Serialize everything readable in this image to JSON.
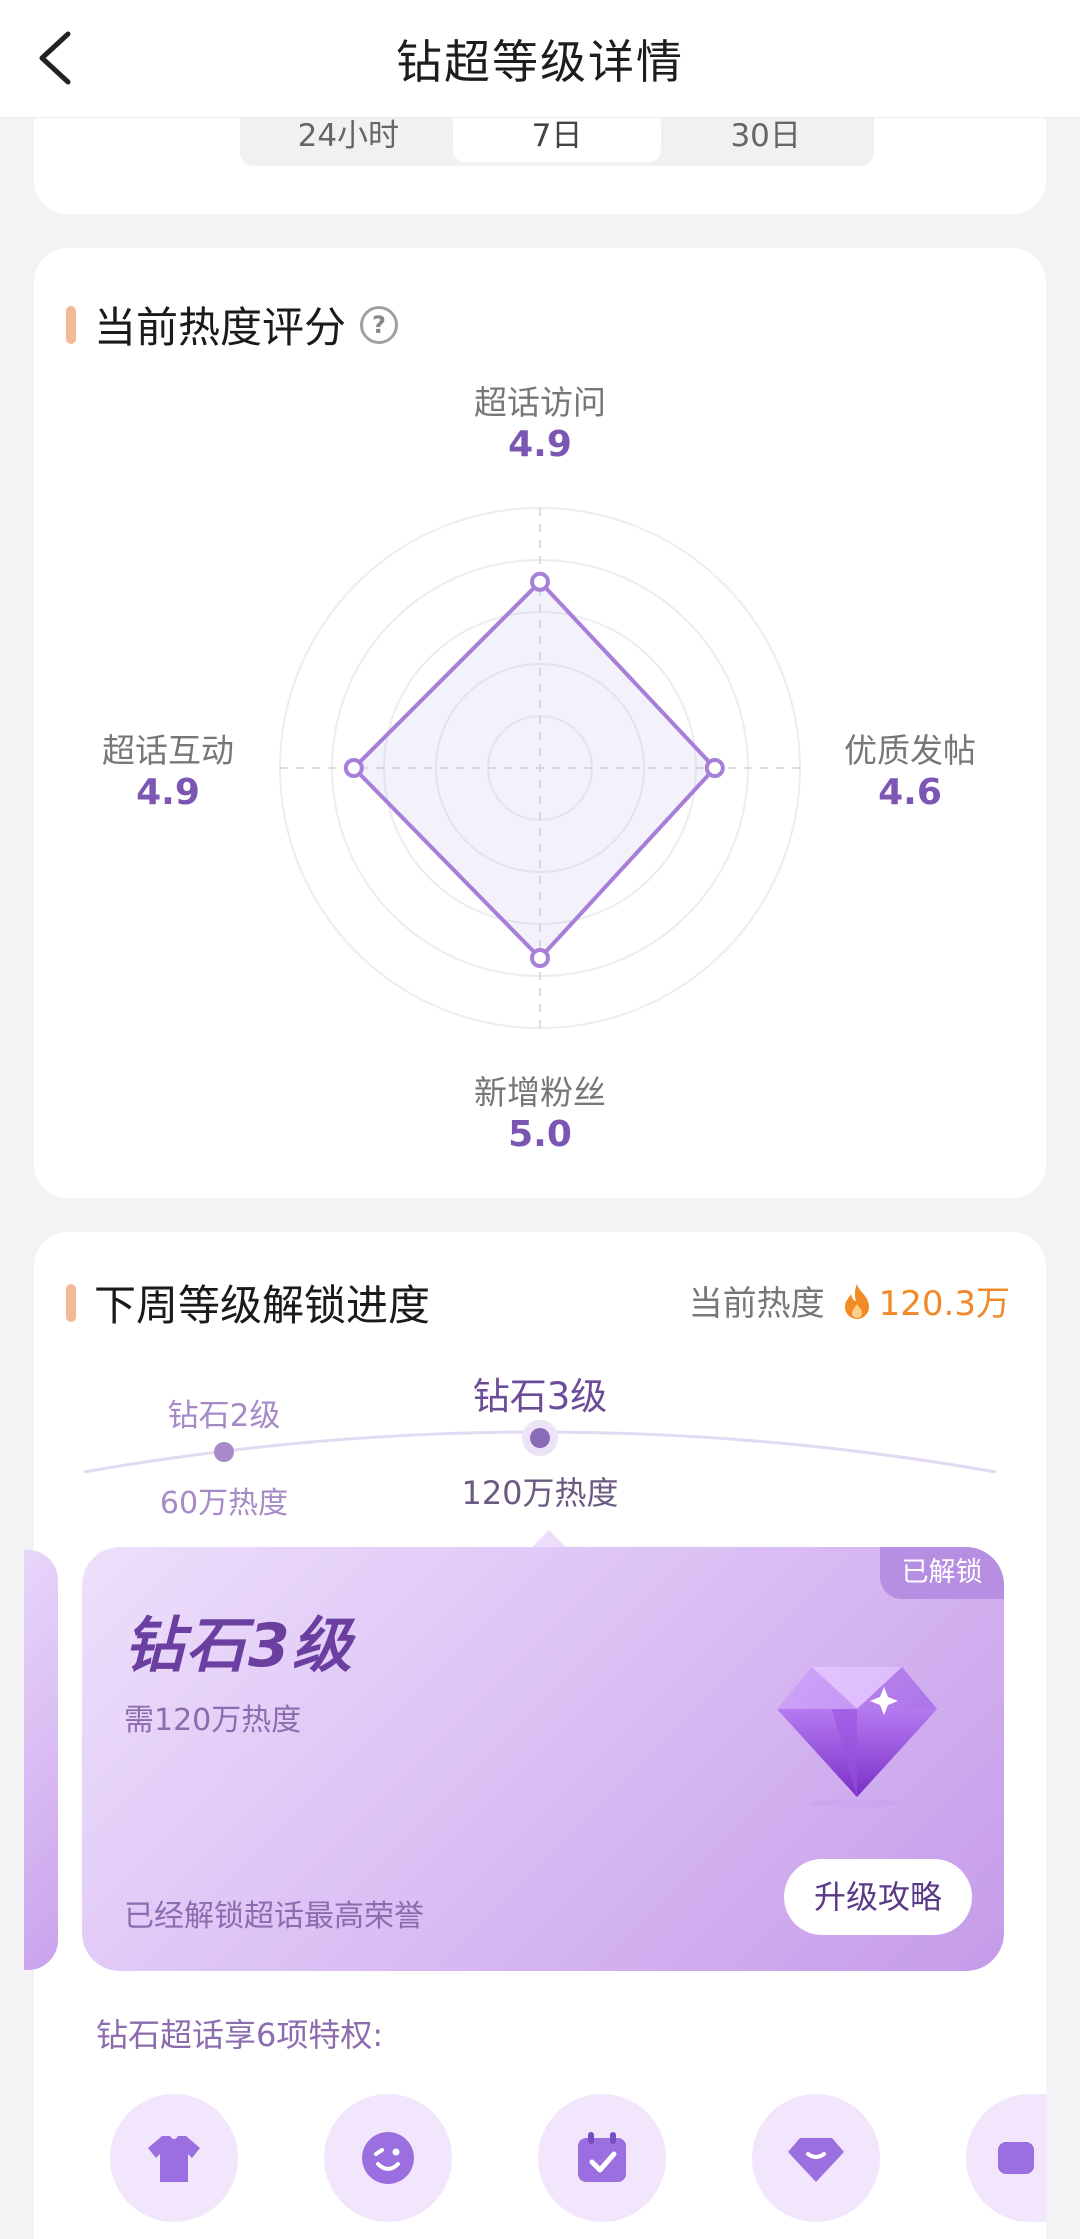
{
  "header": {
    "title": "钻超等级详情"
  },
  "tabs": [
    {
      "label": "24小时",
      "active": false
    },
    {
      "label": "7日",
      "active": true
    },
    {
      "label": "30日",
      "active": false
    }
  ],
  "radar_section": {
    "title": "当前热度评分",
    "axes": [
      {
        "name": "超话访问",
        "value": "4.9"
      },
      {
        "name": "优质发帖",
        "value": "4.6"
      },
      {
        "name": "新增粉丝",
        "value": "5.0"
      },
      {
        "name": "超话互动",
        "value": "4.9"
      }
    ],
    "max": 5
  },
  "progress_section": {
    "title": "下周等级解锁进度",
    "current_heat_label": "当前热度",
    "current_heat_value": "120.3万",
    "levels": [
      {
        "name": "钻石2级",
        "heat": "60万热度"
      },
      {
        "name": "钻石3级",
        "heat": "120万热度"
      }
    ],
    "card": {
      "badge": "已解锁",
      "title": "钻石3级",
      "requirement": "需120万热度",
      "description": "已经解锁超话最高荣誉",
      "button": "升级攻略"
    },
    "privileges_title": "钻石超话享6项特权:",
    "privilege_icons": [
      "tshirt-icon",
      "emoji-icon",
      "calendar-icon",
      "diamond-icon",
      "partial-icon"
    ]
  },
  "colors": {
    "accent": "#7b56b3",
    "heat": "#f08a28",
    "title_bar": "#f2b996"
  }
}
